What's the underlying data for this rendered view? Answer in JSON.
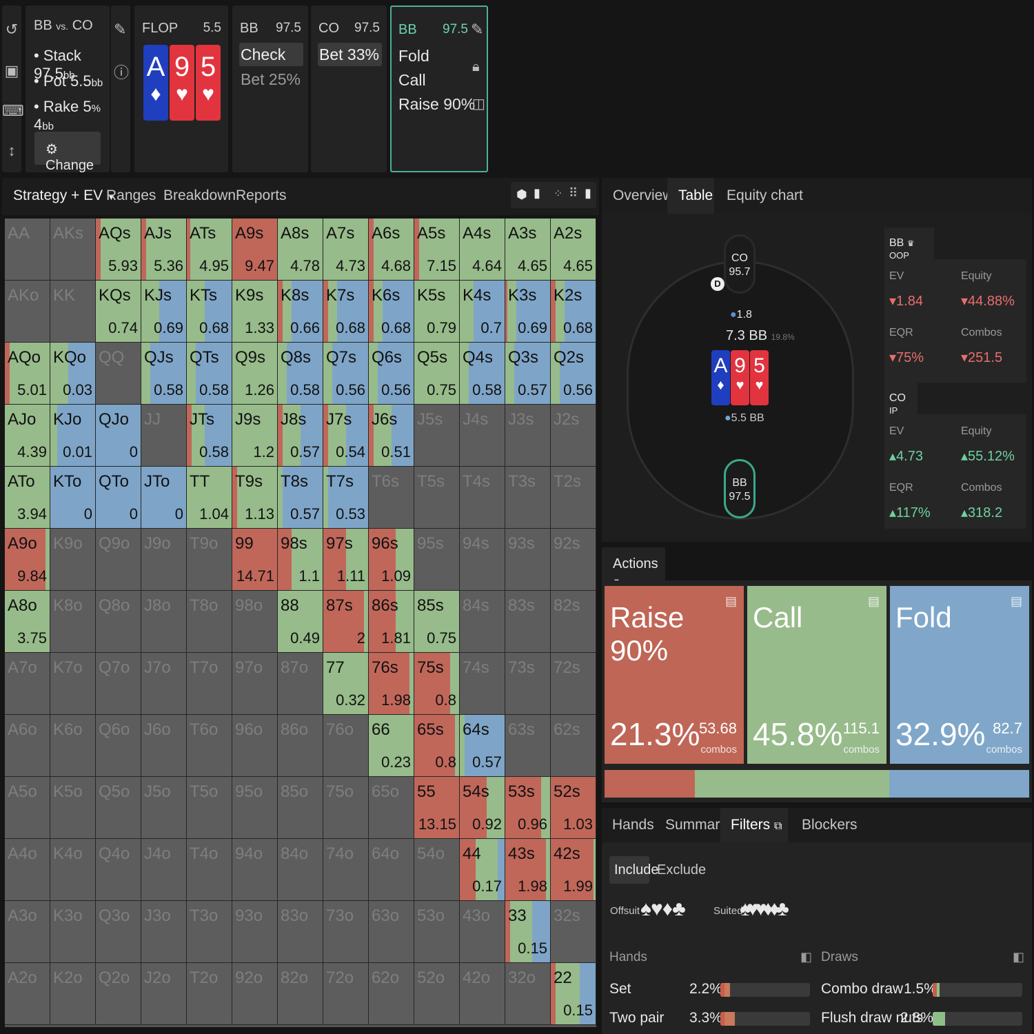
{
  "rail": {
    "icons": [
      "reset-icon",
      "save-icon",
      "gamepad-icon",
      "resize-icon"
    ]
  },
  "spot": {
    "title_a": "BB",
    "title_vs": "vs.",
    "title_b": "CO",
    "stack_label": "Stack",
    "stack_value": "97.5",
    "stack_unit": "bb",
    "pot_label": "Pot",
    "pot_value": "5.5",
    "pot_unit": "bb",
    "rake_label": "Rake",
    "rake_pct": "5",
    "rake_pct_unit": "%",
    "rake_cap": "4",
    "rake_cap_unit": "bb",
    "change_label": "Change"
  },
  "flop": {
    "label": "FLOP",
    "pot": "5.5",
    "cards": [
      {
        "rank": "A",
        "suit": "♦",
        "color": "blue"
      },
      {
        "rank": "9",
        "suit": "♥",
        "color": "red"
      },
      {
        "rank": "5",
        "suit": "♥",
        "color": "red"
      }
    ]
  },
  "node_bb": {
    "player": "BB",
    "stack": "97.5",
    "options": [
      "Check",
      "Bet 25%"
    ]
  },
  "node_co": {
    "player": "CO",
    "stack": "97.5",
    "options": [
      "Bet 33%"
    ]
  },
  "node_active": {
    "player": "BB",
    "stack": "97.5",
    "options": [
      "Fold",
      "Call",
      "Raise 90%"
    ]
  },
  "left_tabs": {
    "strategy": "Strategy + EV",
    "ranges": "Ranges",
    "breakdown": "Breakdown",
    "reports": "Reports"
  },
  "right_tabs": {
    "overview": "Overview",
    "table": "Table",
    "equity": "Equity chart"
  },
  "colors": {
    "raise": "#c0675a",
    "call": "#97bb8a",
    "fold": "#7ea5c8",
    "empty": "#5d5d5d"
  },
  "grid": [
    [
      "AA",
      "AKs",
      "AQs|5.93|r10,c90",
      "AJs|5.36|r10,c90",
      "ATs|4.95|r8,c92",
      "A9s|9.47|r100",
      "A8s|4.78|c100",
      "A7s|4.73|c100",
      "A6s|4.68|r10,c90",
      "A5s|7.15|r10,c90",
      "A4s|4.64|c100",
      "A3s|4.65|c100",
      "A2s|4.65|c100"
    ],
    [
      "AKo",
      "KK",
      "KQs|0.74|c100",
      "KJs|0.69|c40,f60",
      "KTs|0.68|c40,f60",
      "K9s|1.33|c100",
      "K8s|0.66|r10,c20,f70",
      "K7s|0.68|r10,c20,f70",
      "K6s|0.68|r10,c20,f70",
      "K5s|0.79|c100",
      "K4s|0.7|c30,f70",
      "K3s|0.69|r5,c20,f75",
      "K2s|0.68|r10,c20,f70"
    ],
    [
      "AQo|5.01|r10,c90",
      "KQo|0.03|c40,f60",
      "QQ",
      "QJs|0.58|c20,f80",
      "QTs|0.58|c20,f80",
      "Q9s|1.26|c100",
      "Q8s|0.58|c20,f80",
      "Q7s|0.56|c20,f80",
      "Q6s|0.56|c20,f80",
      "Q5s|0.75|c100",
      "Q4s|0.58|c20,f80",
      "Q3s|0.57|c20,f80",
      "Q2s|0.56|c20,f80"
    ],
    [
      "AJo|4.39|c100",
      "KJo|0.01|c15,f85",
      "QJo|0|f100",
      "JJ",
      "JTs|0.58|r10,c30,f60",
      "J9s|1.2|c100",
      "J8s|0.57|r10,c40,f50",
      "J7s|0.54|r10,c40,f50",
      "J6s|0.51|r10,c40,f50",
      "J5s",
      "J4s",
      "J3s",
      "J2s"
    ],
    [
      "ATo|3.94|c100",
      "KTo|0|f100",
      "QTo|0|f100",
      "JTo|0|f100",
      "TT|1.04|c100",
      "T9s|1.13|r10,c90",
      "T8s|0.57|c10,f90",
      "T7s|0.53|c10,f90",
      "T6s",
      "T5s",
      "T4s",
      "T3s",
      "T2s"
    ],
    [
      "A9o|9.84|r90,c10",
      "K9o",
      "Q9o",
      "J9o",
      "T9o",
      "99|14.71|r100",
      "98s|1.1|r30,c70",
      "97s|1.11|r50,c50",
      "96s|1.09|r60,c40",
      "95s",
      "94s",
      "93s",
      "92s"
    ],
    [
      "A8o|3.75|c100",
      "K8o",
      "Q8o",
      "J8o",
      "T8o",
      "98o",
      "88|0.49|c100",
      "87s|2|r90,c10",
      "86s|1.81|r60,c40",
      "85s|0.75|c100",
      "84s",
      "83s",
      "82s"
    ],
    [
      "A7o",
      "K7o",
      "Q7o",
      "J7o",
      "T7o",
      "97o",
      "87o",
      "77|0.32|c100",
      "76s|1.98|r90,c10",
      "75s|0.8|r80,c20",
      "74s",
      "73s",
      "72s"
    ],
    [
      "A6o",
      "K6o",
      "Q6o",
      "J6o",
      "T6o",
      "96o",
      "86o",
      "76o",
      "66|0.23|c100",
      "65s|0.8|r90,c10",
      "64s|0.57|c10,f90",
      "63s",
      "62s"
    ],
    [
      "A5o",
      "K5o",
      "Q5o",
      "J5o",
      "T5o",
      "95o",
      "85o",
      "75o",
      "65o",
      "55|13.15|r100",
      "54s|0.92|r60,c40",
      "53s|0.96|r80,c20",
      "52s|1.03|r100"
    ],
    [
      "A4o",
      "K4o",
      "Q4o",
      "J4o",
      "T4o",
      "94o",
      "84o",
      "74o",
      "64o",
      "54o",
      "44|0.17|r35,c50,f15",
      "43s|1.98|r90,c10",
      "42s|1.99|r95,c5"
    ],
    [
      "A3o",
      "K3o",
      "Q3o",
      "J3o",
      "T3o",
      "93o",
      "83o",
      "73o",
      "63o",
      "53o",
      "43o",
      "33|0.15|r10,c50,f40",
      "32s"
    ],
    [
      "A2o",
      "K2o",
      "Q2o",
      "J2o",
      "T2o",
      "92o",
      "82o",
      "72o",
      "62o",
      "52o",
      "42o",
      "32o",
      "22|0.15|r10,c55,f35"
    ]
  ],
  "table": {
    "co_seat": {
      "name": "CO",
      "stack": "95.7"
    },
    "bb_seat": {
      "name": "BB",
      "stack": "97.5"
    },
    "dealer": "D",
    "bet": "1.8",
    "pot": "7.3 BB",
    "pot_pct": "19.8%",
    "pot_start": "5.5 BB",
    "cards": [
      {
        "rank": "A",
        "suit": "♦",
        "color": "blue"
      },
      {
        "rank": "9",
        "suit": "♥",
        "color": "red"
      },
      {
        "rank": "5",
        "suit": "♥",
        "color": "red"
      }
    ]
  },
  "bb_stats": {
    "name": "BB",
    "pos": "OOP",
    "ev_label": "EV",
    "ev": "1.84",
    "eq_label": "Equity",
    "eq": "44.88%",
    "eqr_label": "EQR",
    "eqr": "75%",
    "combos_label": "Combos",
    "combos": "251.5"
  },
  "co_stats": {
    "name": "CO",
    "pos": "IP",
    "ev_label": "EV",
    "ev": "4.73",
    "eq_label": "Equity",
    "eq": "55.12%",
    "eqr_label": "EQR",
    "eqr": "117%",
    "combos_label": "Combos",
    "combos": "318.2"
  },
  "actions": {
    "label": "Actions",
    "items": [
      {
        "name": "Raise 90%",
        "pct": "21.3%",
        "combos": "53.68",
        "combos_label": "combos",
        "share": 0.213
      },
      {
        "name": "Call",
        "pct": "45.8%",
        "combos": "115.1",
        "combos_label": "combos",
        "share": 0.458
      },
      {
        "name": "Fold",
        "pct": "32.9%",
        "combos": "82.7",
        "combos_label": "combos",
        "share": 0.329
      }
    ]
  },
  "bottom_tabs": {
    "hands": "Hands",
    "summary": "Summary",
    "filters": "Filters",
    "blockers": "Blockers"
  },
  "filters": {
    "include": "Include",
    "exclude": "Exclude",
    "offsuit": "Offsuit",
    "suited": "Suited",
    "offsuit_suits": [
      "♠",
      "♥",
      "♦",
      "♣"
    ],
    "suited_suits": [
      "♠♥",
      "♥♦",
      "♦♣"
    ],
    "hands_header": "Hands",
    "draws_header": "Draws",
    "hands": [
      {
        "label": "Set",
        "pct": "2.2%",
        "value": 0.022
      },
      {
        "label": "Two pair",
        "pct": "3.3%",
        "value": 0.033
      }
    ],
    "draws": [
      {
        "label": "Combo draw",
        "pct": "1.5%",
        "value": 0.015
      },
      {
        "label": "Flush draw nuts",
        "pct": "2.8%",
        "value": 0.028
      }
    ]
  }
}
